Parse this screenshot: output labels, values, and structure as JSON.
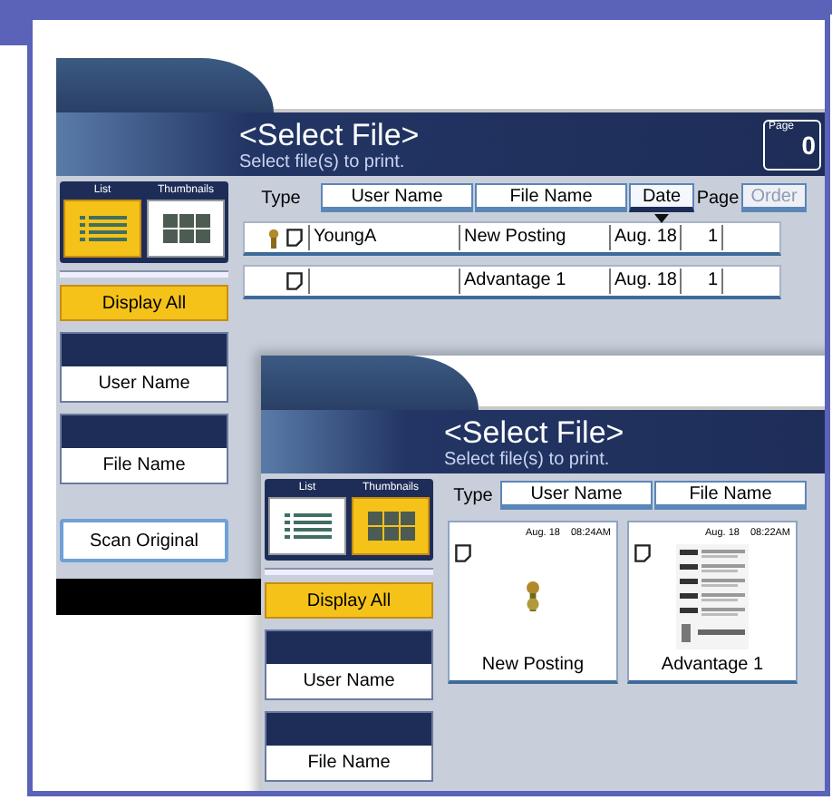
{
  "screens": [
    {
      "title": "<Select File>",
      "subtitle": "Select file(s) to print.",
      "page_counter": {
        "label": "Page",
        "value": "0"
      },
      "view_modes": [
        {
          "label": "List",
          "selected": true
        },
        {
          "label": "Thumbnails",
          "selected": false
        }
      ],
      "display_all": "Display All",
      "filters": [
        "User Name",
        "File Name"
      ],
      "scan_button": "Scan Original",
      "columns": [
        {
          "label": "Type",
          "kind": "label"
        },
        {
          "label": "User Name",
          "kind": "button"
        },
        {
          "label": "File Name",
          "kind": "button"
        },
        {
          "label": "Date",
          "kind": "button",
          "sorted": true
        },
        {
          "label": "Page",
          "kind": "label"
        },
        {
          "label": "Order",
          "kind": "button",
          "disabled": true
        }
      ],
      "files": [
        {
          "locked": true,
          "user": "YoungA",
          "name": "New Posting",
          "date": "Aug. 18",
          "pages": "1"
        },
        {
          "locked": false,
          "name": "Advantage 1",
          "date": "Aug. 18",
          "pages": "1"
        }
      ]
    },
    {
      "title": "<Select File>",
      "subtitle": "Select file(s) to print.",
      "view_modes": [
        {
          "label": "List",
          "selected": false
        },
        {
          "label": "Thumbnails",
          "selected": true
        }
      ],
      "display_all": "Display All",
      "filters": [
        "User Name",
        "File Name"
      ],
      "columns": [
        {
          "label": "Type",
          "kind": "label"
        },
        {
          "label": "User Name",
          "kind": "button"
        },
        {
          "label": "File Name",
          "kind": "button"
        }
      ],
      "files": [
        {
          "date": "Aug. 18",
          "time": "08:24AM",
          "name": "New Posting",
          "kind": "key"
        },
        {
          "date": "Aug. 18",
          "time": "08:22AM",
          "name": "Advantage 1",
          "kind": "document"
        }
      ]
    }
  ]
}
